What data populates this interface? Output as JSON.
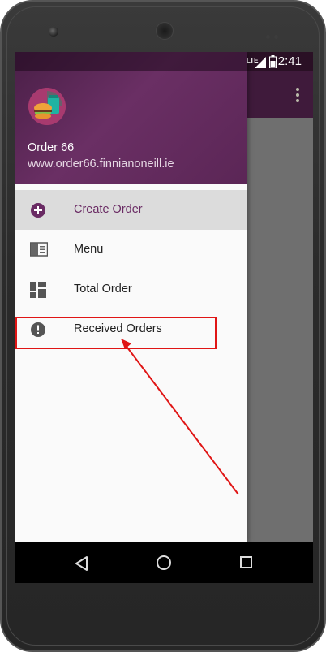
{
  "status_bar": {
    "time": "2:41",
    "network": "LTE",
    "left_icons": [
      "sd-card-icon",
      "n-logo-icon"
    ],
    "right_icons": [
      "lte-signal-icon",
      "battery-icon"
    ]
  },
  "drawer": {
    "header": {
      "title": "Order 66",
      "subtitle": "www.order66.finnianoneill.ie"
    },
    "items": [
      {
        "label": "Create Order",
        "icon": "add-circle-icon",
        "active": true
      },
      {
        "label": "Menu",
        "icon": "menu-book-icon",
        "active": false
      },
      {
        "label": "Total Order",
        "icon": "dashboard-icon",
        "active": false
      },
      {
        "label": "Received Orders",
        "icon": "alert-circle-icon",
        "active": false
      }
    ]
  },
  "colors": {
    "accent": "#6a2b64",
    "header": "#5b2656",
    "annotation": "#e01515"
  },
  "nav_bar": {
    "icons": [
      "back-icon",
      "home-icon",
      "recents-icon"
    ]
  }
}
